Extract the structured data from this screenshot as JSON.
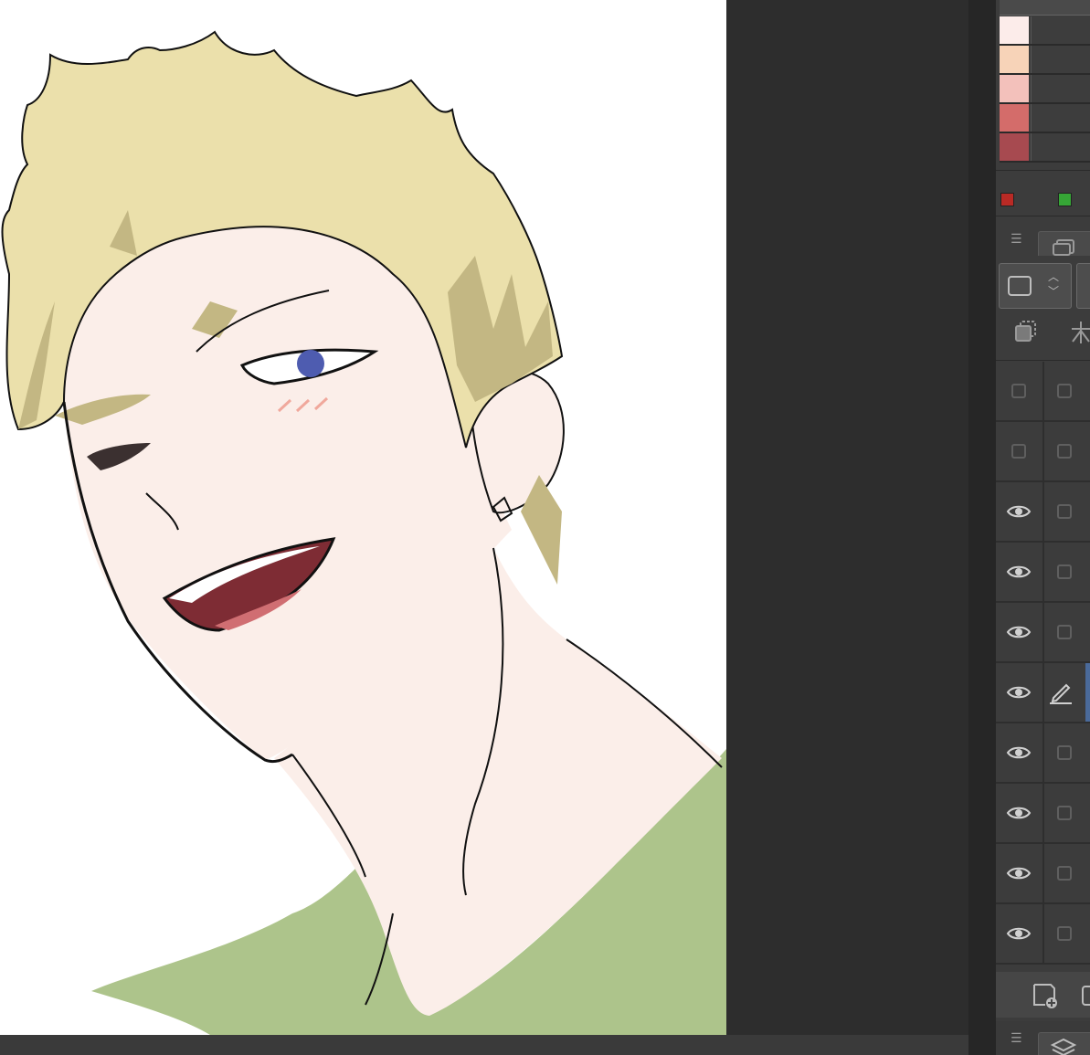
{
  "app": {
    "name": "",
    "canvas_background": "#ffffff",
    "workspace_background": "#2d2d2d"
  },
  "color_set": {
    "swatches": [
      "#fcecea",
      "#f7d3b8",
      "#f3c1bb",
      "#d46c6a",
      "#a74a50"
    ]
  },
  "color_indicators": {
    "red": "#b92a25",
    "green": "#36a636"
  },
  "layer_panel": {
    "menu_icon": "hamburger-menu-icon",
    "blend_mode_icon": "square-icon",
    "rows": [
      {
        "visible": false,
        "editing": false,
        "selected": false
      },
      {
        "visible": false,
        "editing": false,
        "selected": false
      },
      {
        "visible": true,
        "editing": false,
        "selected": false
      },
      {
        "visible": true,
        "editing": false,
        "selected": false
      },
      {
        "visible": true,
        "editing": false,
        "selected": false
      },
      {
        "visible": true,
        "editing": true,
        "selected": true
      },
      {
        "visible": true,
        "editing": false,
        "selected": false
      },
      {
        "visible": true,
        "editing": false,
        "selected": false
      },
      {
        "visible": true,
        "editing": false,
        "selected": false
      },
      {
        "visible": true,
        "editing": false,
        "selected": false
      }
    ],
    "footer_icons": [
      "new-layer-icon",
      "folder-icon"
    ]
  },
  "artwork": {
    "subject": "",
    "colors": {
      "skin": "#fbeee9",
      "hair": "#ebe0ab",
      "hair_shadow": "#c3b783",
      "shirt": "#adc48b",
      "mouth": "#7e2c34",
      "tongue": "#d06e72",
      "eye": "#4e5cb0",
      "line": "#111111"
    }
  }
}
